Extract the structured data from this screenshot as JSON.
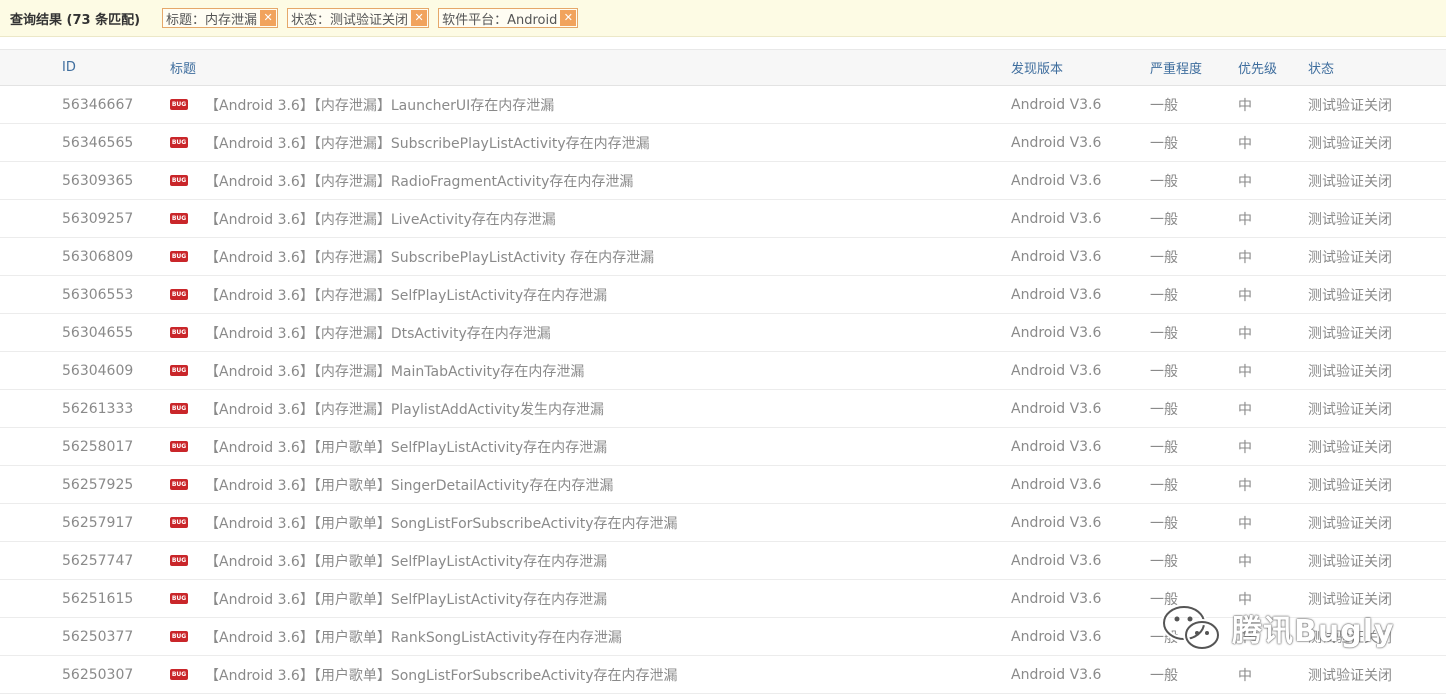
{
  "filters": {
    "result_label": "查询结果 (73 条匹配)",
    "chips": [
      {
        "label": "标题：内存泄漏",
        "close": "✕"
      },
      {
        "label": "状态：测试验证关闭",
        "close": "✕"
      },
      {
        "label": "软件平台：Android",
        "close": "✕"
      }
    ]
  },
  "table": {
    "headers": {
      "id": "ID",
      "title": "标题",
      "version": "发现版本",
      "severity": "严重程度",
      "priority": "优先级",
      "status": "状态"
    },
    "badge": "BUG",
    "rows": [
      {
        "id": "56346667",
        "title": "【Android 3.6】【内存泄漏】LauncherUI存在内存泄漏",
        "version": "Android V3.6",
        "severity": "一般",
        "priority": "中",
        "status": "测试验证关闭"
      },
      {
        "id": "56346565",
        "title": "【Android 3.6】【内存泄漏】SubscribePlayListActivity存在内存泄漏",
        "version": "Android V3.6",
        "severity": "一般",
        "priority": "中",
        "status": "测试验证关闭"
      },
      {
        "id": "56309365",
        "title": "【Android 3.6】【内存泄漏】RadioFragmentActivity存在内存泄漏",
        "version": "Android V3.6",
        "severity": "一般",
        "priority": "中",
        "status": "测试验证关闭"
      },
      {
        "id": "56309257",
        "title": "【Android 3.6】【内存泄漏】LiveActivity存在内存泄漏",
        "version": "Android V3.6",
        "severity": "一般",
        "priority": "中",
        "status": "测试验证关闭"
      },
      {
        "id": "56306809",
        "title": "【Android 3.6】【内存泄漏】SubscribePlayListActivity 存在内存泄漏",
        "version": "Android V3.6",
        "severity": "一般",
        "priority": "中",
        "status": "测试验证关闭"
      },
      {
        "id": "56306553",
        "title": "【Android 3.6】【内存泄漏】SelfPlayListActivity存在内存泄漏",
        "version": "Android V3.6",
        "severity": "一般",
        "priority": "中",
        "status": "测试验证关闭"
      },
      {
        "id": "56304655",
        "title": "【Android 3.6】【内存泄漏】DtsActivity存在内存泄漏",
        "version": "Android V3.6",
        "severity": "一般",
        "priority": "中",
        "status": "测试验证关闭"
      },
      {
        "id": "56304609",
        "title": "【Android 3.6】【内存泄漏】MainTabActivity存在内存泄漏",
        "version": "Android V3.6",
        "severity": "一般",
        "priority": "中",
        "status": "测试验证关闭"
      },
      {
        "id": "56261333",
        "title": "【Android 3.6】【内存泄漏】PlaylistAddActivity发生内存泄漏",
        "version": "Android V3.6",
        "severity": "一般",
        "priority": "中",
        "status": "测试验证关闭"
      },
      {
        "id": "56258017",
        "title": "【Android 3.6】【用户歌单】SelfPlayListActivity存在内存泄漏",
        "version": "Android V3.6",
        "severity": "一般",
        "priority": "中",
        "status": "测试验证关闭"
      },
      {
        "id": "56257925",
        "title": "【Android 3.6】【用户歌单】SingerDetailActivity存在内存泄漏",
        "version": "Android V3.6",
        "severity": "一般",
        "priority": "中",
        "status": "测试验证关闭"
      },
      {
        "id": "56257917",
        "title": "【Android 3.6】【用户歌单】SongListForSubscribeActivity存在内存泄漏",
        "version": "Android V3.6",
        "severity": "一般",
        "priority": "中",
        "status": "测试验证关闭"
      },
      {
        "id": "56257747",
        "title": "【Android 3.6】【用户歌单】SelfPlayListActivity存在内存泄漏",
        "version": "Android V3.6",
        "severity": "一般",
        "priority": "中",
        "status": "测试验证关闭"
      },
      {
        "id": "56251615",
        "title": "【Android 3.6】【用户歌单】SelfPlayListActivity存在内存泄漏",
        "version": "Android V3.6",
        "severity": "一般",
        "priority": "中",
        "status": "测试验证关闭"
      },
      {
        "id": "56250377",
        "title": "【Android 3.6】【用户歌单】RankSongListActivity存在内存泄漏",
        "version": "Android V3.6",
        "severity": "一般",
        "priority": "中",
        "status": "测试验证关闭"
      },
      {
        "id": "56250307",
        "title": "【Android 3.6】【用户歌单】SongListForSubscribeActivity存在内存泄漏",
        "version": "Android V3.6",
        "severity": "一般",
        "priority": "中",
        "status": "测试验证关闭"
      }
    ]
  },
  "watermark": {
    "text": "腾讯Bugly",
    "icon": "wechat-icon"
  }
}
